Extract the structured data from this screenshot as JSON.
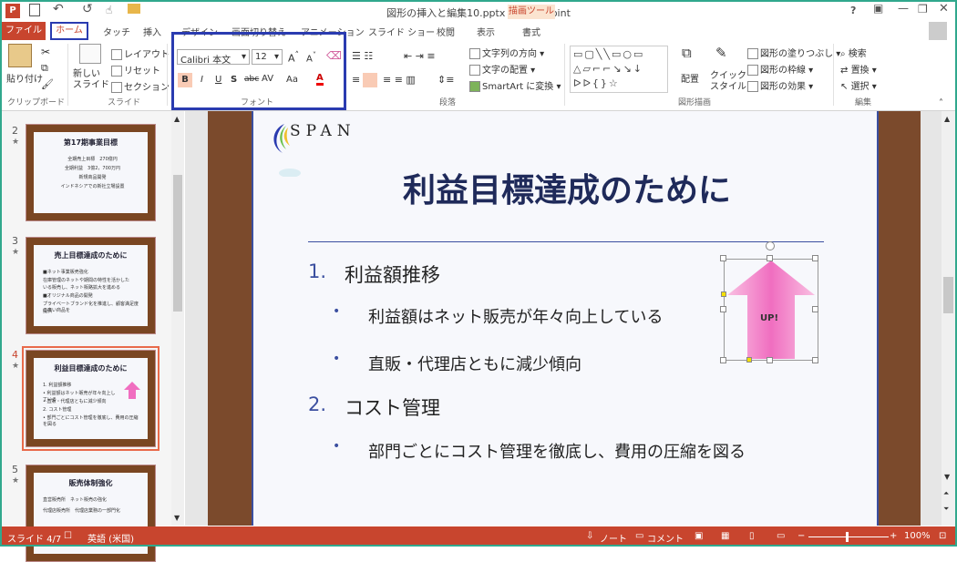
{
  "window": {
    "title": "図形の挿入と編集10.pptx - PowerPoint",
    "help": "?"
  },
  "tabs": [
    "ファイル",
    "ホーム",
    "タッチ",
    "挿入",
    "デザイン",
    "画面切り替え",
    "アニメーション",
    "スライド ショー",
    "校閲",
    "表示",
    "書式"
  ],
  "context_tab": "描画ツール",
  "ribbon": {
    "clipboard": {
      "paste": "貼り付け",
      "group": "クリップボード"
    },
    "slides": {
      "new_slide": "新しい\nスライド",
      "layout": "レイアウト",
      "reset": "リセット",
      "section": "セクション",
      "group": "スライド"
    },
    "font": {
      "name": "Calibri 本文",
      "size": "12",
      "group": "フォント",
      "bold": "B",
      "italic": "I",
      "underline": "U",
      "shadow": "S",
      "strike": "abc",
      "spacing": "AV",
      "case": "Aa",
      "color": "A"
    },
    "paragraph": {
      "text_direction": "文字列の方向",
      "align_text": "文字の配置",
      "smartart": "SmartArt に変換",
      "group": "段落"
    },
    "drawing": {
      "arrange": "配置",
      "quick_styles": "クイック\nスタイル",
      "fill": "図形の塗りつぶし",
      "outline": "図形の枠線",
      "effects": "図形の効果",
      "group": "図形描画"
    },
    "editing": {
      "find": "検索",
      "replace": "置換",
      "select": "選択",
      "group": "編集"
    }
  },
  "thumbnails": [
    {
      "num": "2",
      "title": "第17期事業目標",
      "lines": [
        "全期売上目標　270億円",
        "全期利益　3億2，700万円",
        "新規商品開発",
        "インドネシアでの新社立場設置"
      ]
    },
    {
      "num": "3",
      "title": "売上目標達成のために",
      "lines": [
        "■ネット事業販売強化",
        "在庫管理のネットや期間の特性を活かした",
        "いる販売し、ネット販路拡大を進める",
        "■オリジナル商品の開発",
        "プライベートブランド化を推進し、顧客満足度の高い商品を",
        "提供"
      ]
    },
    {
      "num": "4",
      "title": "利益目標達成のために",
      "lines": [
        "1. 利益額推移",
        "• 利益額はネット販売が年々向上している",
        "• 直販・代理店ともに減少傾向",
        "2. コスト管理",
        "• 部門ごとにコスト管理を徹底し、費用の圧縮を図る"
      ]
    },
    {
      "num": "5",
      "title": "販売体制強化",
      "lines": [
        "直営販売所　ネット販売の強化",
        "代理店販売所　代理店業務の一部門化"
      ]
    }
  ],
  "slide": {
    "logo": "SPAN",
    "title": "利益目標達成のために",
    "items": [
      {
        "num": "1.",
        "text": "利益額推移",
        "bullets": [
          "利益額はネット販売が年々向上している",
          "直販・代理店ともに減少傾向"
        ]
      },
      {
        "num": "2.",
        "text": "コスト管理",
        "bullets": [
          "部門ごとにコスト管理を徹底し、費用の圧縮を図る"
        ]
      }
    ],
    "arrow_label": "UP!"
  },
  "status": {
    "slide": "スライド 4/7",
    "language": "英語 (米国)",
    "notes": "ノート",
    "comments": "コメント",
    "zoom": "100%"
  },
  "colors": {
    "accent": "#c8452e",
    "slide_title": "#1f2a5a",
    "border": "#3b4fa0",
    "highlight_box": "#2a3bb0",
    "arrow_pink": "#f06ec0"
  }
}
